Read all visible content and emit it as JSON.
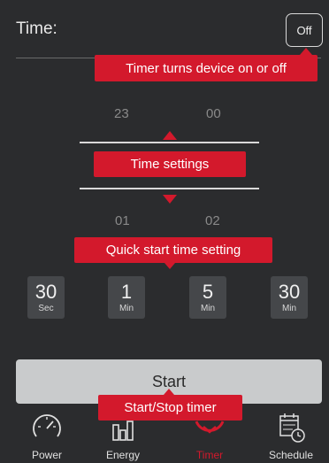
{
  "header": {
    "title": "Time:",
    "off_label": "Off"
  },
  "callouts": {
    "timer_on_off": "Timer turns device on or off",
    "time_settings": "Time settings",
    "quick_start": "Quick start time setting",
    "start_stop": "Start/Stop timer"
  },
  "wheel": {
    "hour_prev": "23",
    "minute_prev": "00",
    "hour_next": "01",
    "minute_next": "02"
  },
  "quick_buttons": [
    {
      "value": "30",
      "unit": "Sec"
    },
    {
      "value": "1",
      "unit": "Min"
    },
    {
      "value": "5",
      "unit": "Min"
    },
    {
      "value": "30",
      "unit": "Min"
    }
  ],
  "start_label": "Start",
  "nav": {
    "items": [
      {
        "label": "Power",
        "icon": "gauge-icon"
      },
      {
        "label": "Energy",
        "icon": "bar-chart-icon"
      },
      {
        "label": "Timer",
        "icon": "timer-icon",
        "active": true
      },
      {
        "label": "Schedule",
        "icon": "calendar-clock-icon"
      }
    ],
    "active_color": "#d3192c"
  },
  "colors": {
    "accent": "#d3192c",
    "background": "#2b2c2e",
    "button": "#45474a"
  }
}
